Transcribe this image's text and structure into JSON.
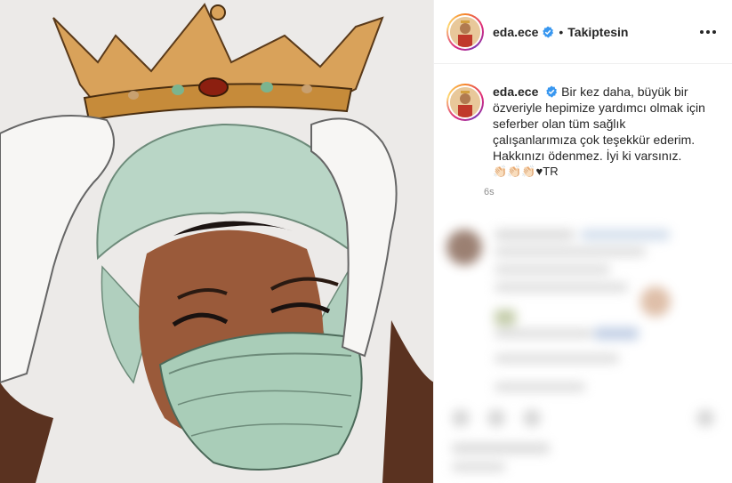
{
  "header": {
    "username": "eda.ece",
    "follow_status": "Takiptesin",
    "separator": "•"
  },
  "caption": {
    "username": "eda.ece",
    "line1": "Bir kez daha, büyük bir özveriyle hepimize yardımcı olmak için seferber olan tüm sağlık çalışanlarımıza çok teşekkür ederim. Hakkınızı ödenmez. İyi ki varsınız.",
    "emojis": "👏🏻👏🏻👏🏻♥TR",
    "timestamp": "6s"
  },
  "colors": {
    "verified": "#3897f0",
    "text": "#262626",
    "muted": "#8e8e8e",
    "border": "#efefef"
  },
  "icons": {
    "verified": "verified-badge-icon",
    "more": "more-options-icon"
  }
}
